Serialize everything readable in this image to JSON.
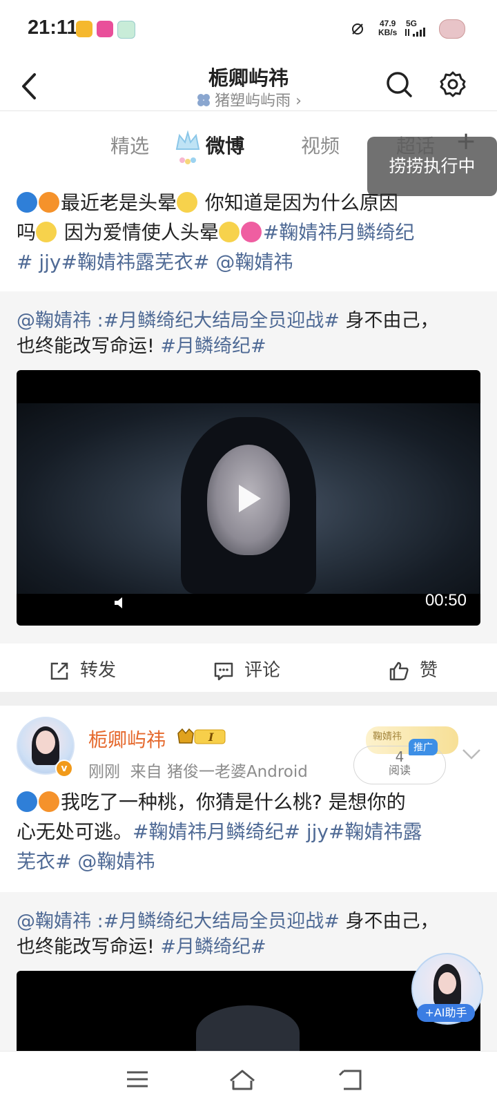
{
  "status_bar": {
    "time": "21:11",
    "speed_value": "47.9",
    "speed_unit": "KB/s",
    "network": "5G"
  },
  "header": {
    "title": "栀卿屿祎",
    "subtitle": "猪塑屿屿雨",
    "subtitle_chevron": "›"
  },
  "tabs": [
    {
      "label": "精选"
    },
    {
      "label": "微博",
      "active": true
    },
    {
      "label": "视频"
    },
    {
      "label": "超话"
    }
  ],
  "add_tab": "+",
  "toast": "捞捞执行中",
  "post1": {
    "line1": "最近老是头晕",
    "line1b": " 你知道是因为什么原因",
    "line2a": "吗",
    "line2b": " 因为爱情使人头晕",
    "topic1": "#鞠婧祎月鳞绮纪",
    "topic2": "# jjy",
    "topic3": "#鞠婧祎露芜衣#",
    "mention": " @鞠婧祎",
    "repost_user": "@鞠婧祎",
    "repost_sep": " :",
    "repost_topic1": "#月鳞绮纪大结局全员迎战#",
    "repost_text1": " 身不由己，",
    "repost_text2": "也终能改写命运!",
    "repost_topic2": " #月鳞绮纪#",
    "video_duration": "00:50",
    "actions": {
      "repost": "转发",
      "comment": "评论",
      "like": "赞"
    }
  },
  "post2": {
    "username": "栀卿屿祎",
    "vip_label": "I",
    "time": "刚刚",
    "source_prefix": "来自",
    "source": "猪俊一老婆Android",
    "read_count": "4",
    "read_label": "阅读",
    "promo": "推广",
    "sticker_text": "鞠婧祎",
    "text1": "我吃了一种桃，你猜是什么桃? 是想你的",
    "text2": "心无处可逃。",
    "topic1": "#鞠婧祎月鳞绮纪#",
    "topic2": " jjy",
    "topic3": "#鞠婧祎露",
    "topic3b": "芜衣#",
    "mention": "  @鞠婧祎",
    "repost_user": "@鞠婧祎",
    "repost_sep": " :",
    "repost_topic1": "#月鳞绮纪大结局全员迎战#",
    "repost_text1": " 身不由己，",
    "repost_text2": "也终能改写命运!",
    "repost_topic2": " #月鳞绮纪#"
  },
  "ai_helper": "+AI助手",
  "colors": {
    "topic": "#4f6a95",
    "username": "#e5682c",
    "toast_bg": "#5a5a5a",
    "promo": "#3d8fe6"
  }
}
